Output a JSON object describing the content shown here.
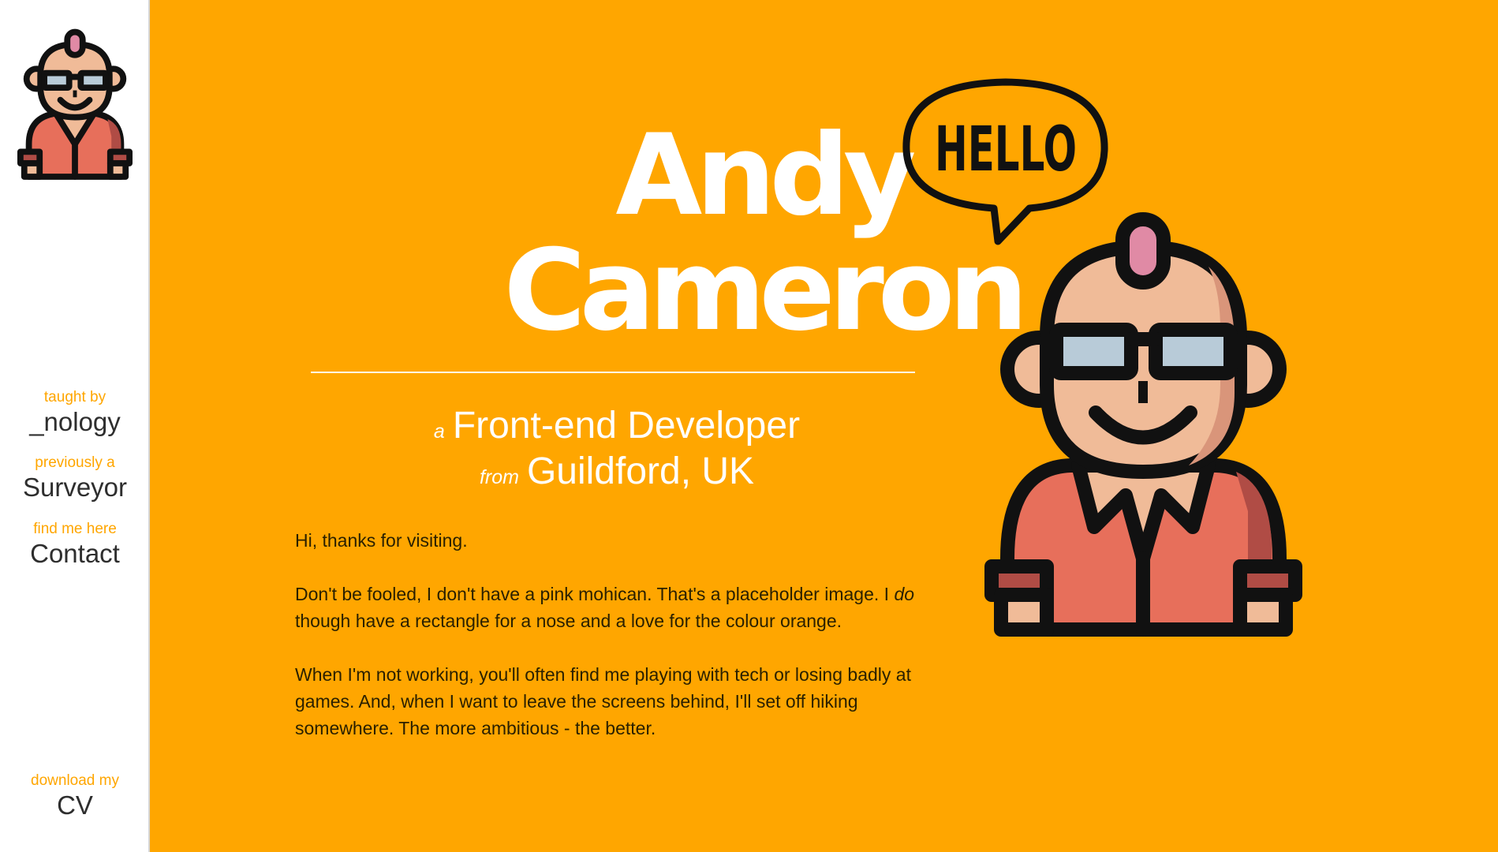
{
  "sidebar": {
    "avatar_icon": "developer-avatar-icon",
    "nav": [
      {
        "caption": "taught by",
        "label": "_nology"
      },
      {
        "caption": "previously a",
        "label": "Surveyor"
      },
      {
        "caption": "find me here",
        "label": "Contact"
      },
      {
        "caption": "download my",
        "label": "CV"
      }
    ]
  },
  "main": {
    "title_first": "Andy",
    "title_last": "Cameron",
    "role_prefix": "a",
    "role": "Front-end Developer",
    "location_prefix": "from",
    "location": "Guildford, UK",
    "speech_bubble_text": "HELLO",
    "intro": {
      "p1": "Hi, thanks for visiting.",
      "p2_a": "Don't be fooled, I don't have a pink mohican. That's a placeholder image. I ",
      "p2_em": "do",
      "p2_b": " though have a rectangle for a nose and a love for the colour orange.",
      "p3": "When I'm not working, you'll often find me playing with tech or losing badly at games. And, when I want to leave the screens behind, I'll set off hiking somewhere. The more ambitious - the better."
    }
  },
  "colors": {
    "accent": "#FFA600",
    "sidebar_bg": "#FFFFFF",
    "text_dark": "#2E2E2E",
    "shirt": "#E76F5B",
    "skin": "#F0BB98",
    "mohican": "#E08AA5",
    "glasses_lens": "#B8CBD8"
  }
}
